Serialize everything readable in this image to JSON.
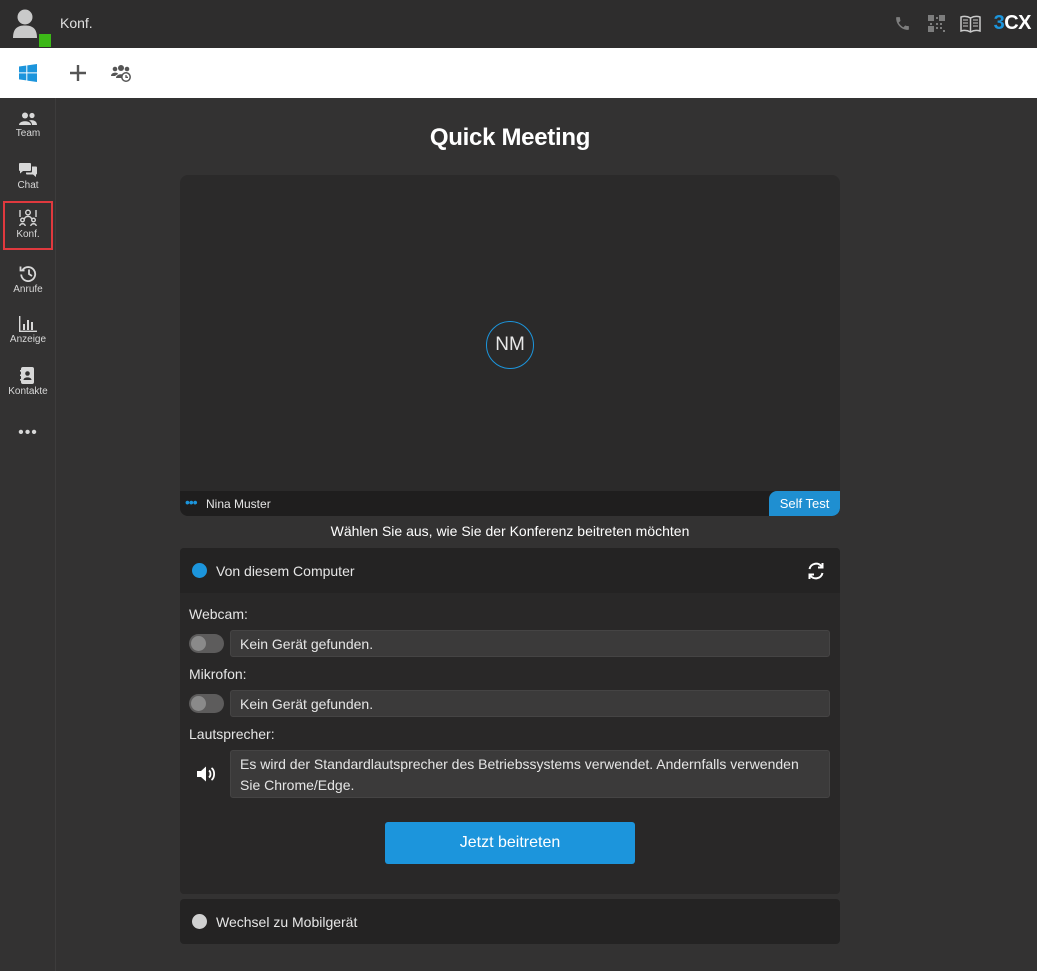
{
  "topbar": {
    "title": "Konf.",
    "icons": [
      "phone-icon",
      "qr-code-icon",
      "book-icon"
    ],
    "brand_prefix": "3",
    "brand_suffix": "CX",
    "status_color": "#3cb817"
  },
  "toolbar": {
    "icons": [
      "windows-icon",
      "plus-icon",
      "group-schedule-icon"
    ]
  },
  "sidebar": {
    "items": [
      {
        "label": "Team",
        "icon": "team-icon"
      },
      {
        "label": "Chat",
        "icon": "chat-icon"
      },
      {
        "label": "Konf.",
        "icon": "conference-icon",
        "active": true
      },
      {
        "label": "Anrufe",
        "icon": "history-icon"
      },
      {
        "label": "Anzeige",
        "icon": "bar-chart-icon"
      },
      {
        "label": "Kontakte",
        "icon": "contacts-icon"
      }
    ],
    "more_label": "•••"
  },
  "main": {
    "title": "Quick Meeting",
    "video": {
      "initials": "NM",
      "name_dots": "•••",
      "participant_name": "Nina Muster",
      "self_test_label": "Self Test"
    },
    "instruction": "Wählen Sie aus, wie Sie der Konferenz beitreten möchten",
    "computer_option": {
      "label": "Von diesem Computer",
      "selected": true,
      "webcam_label": "Webcam:",
      "webcam_value": "Kein Gerät gefunden.",
      "mic_label": "Mikrofon:",
      "mic_value": "Kein Gerät gefunden.",
      "speaker_label": "Lautsprecher:",
      "speaker_info": "Es wird der Standardlautsprecher des Betriebssystems verwendet. Andernfalls verwenden Sie Chrome/Edge.",
      "join_label": "Jetzt beitreten"
    },
    "mobile_option": {
      "label": "Wechsel zu Mobilgerät",
      "selected": false
    }
  },
  "colors": {
    "accent": "#1c95dc",
    "active_outline": "#e0393e",
    "background": "#333232"
  }
}
